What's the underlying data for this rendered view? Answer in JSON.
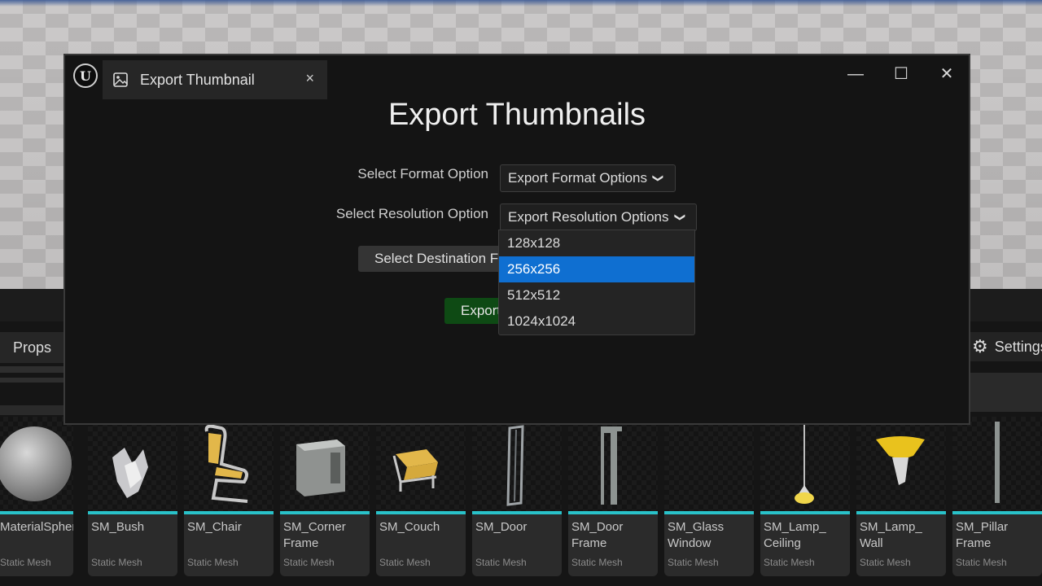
{
  "dialog": {
    "tab_label": "Export Thumbnail",
    "tab_close": "×",
    "title": "Export Thumbnails",
    "format_label": "Select Format Option",
    "format_combo": "Export Format Options",
    "resolution_label": "Select Resolution Option",
    "resolution_combo": "Export Resolution Options",
    "destination_button": "Select Destination Folder",
    "export_button": "Export",
    "window_controls": {
      "minimize": "—",
      "maximize": "☐",
      "close": "✕"
    }
  },
  "resolution_options": [
    "128x128",
    "256x256",
    "512x512",
    "1024x1024"
  ],
  "selected_resolution": "256x256",
  "background": {
    "props_tab": "Props",
    "settings": "Settings"
  },
  "assets": [
    {
      "name": "MaterialSphere",
      "type": "Static Mesh"
    },
    {
      "name": "SM_Bush",
      "type": "Static Mesh"
    },
    {
      "name": "SM_Chair",
      "type": "Static Mesh"
    },
    {
      "name": "SM_Corner\nFrame",
      "type": "Static Mesh"
    },
    {
      "name": "SM_Couch",
      "type": "Static Mesh"
    },
    {
      "name": "SM_Door",
      "type": "Static Mesh"
    },
    {
      "name": "SM_Door\nFrame",
      "type": "Static Mesh"
    },
    {
      "name": "SM_Glass\nWindow",
      "type": "Static Mesh"
    },
    {
      "name": "SM_Lamp_\nCeiling",
      "type": "Static Mesh"
    },
    {
      "name": "SM_Lamp_\nWall",
      "type": "Static Mesh"
    },
    {
      "name": "SM_Pillar\nFrame",
      "type": "Static Mesh"
    }
  ],
  "colors": {
    "accent_selected": "#0f6fd1",
    "asset_bar": "#29c2c9",
    "export_green": "#0e4a14"
  }
}
